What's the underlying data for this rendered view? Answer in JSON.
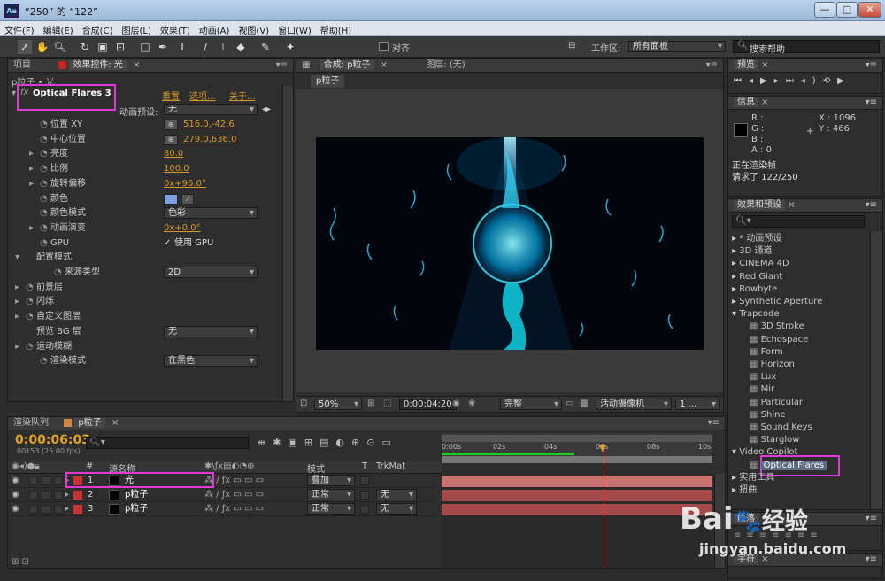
{
  "window": {
    "title": "“250” 的 “122”",
    "min": "—",
    "max": "□",
    "close": "✕"
  },
  "menu": [
    "文件(F)",
    "编辑(E)",
    "合成(C)",
    "图层(L)",
    "效果(T)",
    "动画(A)",
    "视图(V)",
    "窗口(W)",
    "帮助(H)"
  ],
  "toolbar": {
    "align_label": "对齐",
    "workspace_label": "工作区:",
    "workspace_value": "所有面板",
    "search_placeholder": "搜索帮助"
  },
  "left_panel": {
    "tab_project": "项目",
    "tab_effects": "效果控件: 光",
    "breadcrumb": "p粒子 • 光",
    "effect_name": "Optical Flares 3",
    "reset": "重置",
    "options": "选项...",
    "about": "关于...",
    "preset_label": "动画预设:",
    "preset_value": "无",
    "props": [
      {
        "label": "位置 XY",
        "value": "516.0,-42.6"
      },
      {
        "label": "中心位置",
        "value": "279.0,636.0"
      },
      {
        "label": "亮度",
        "value": "80.0"
      },
      {
        "label": "比例",
        "value": "100.0"
      },
      {
        "label": "旋转偏移",
        "value": "0x+96.0°"
      },
      {
        "label": "颜色",
        "value": ""
      },
      {
        "label": "颜色模式",
        "value": "色彩"
      },
      {
        "label": "动画演变",
        "value": "0x+0.0°"
      },
      {
        "label": "GPU",
        "value": "使用 GPU"
      },
      {
        "label": "配置模式",
        "value": ""
      },
      {
        "label": "来源类型",
        "value": "2D"
      },
      {
        "label": "前景层",
        "value": ""
      },
      {
        "label": "闪烁",
        "value": ""
      },
      {
        "label": "自定义图层",
        "value": ""
      },
      {
        "label": "预览 BG 层",
        "value": "无"
      },
      {
        "label": "运动模糊",
        "value": ""
      },
      {
        "label": "渲染模式",
        "value": "在黑色"
      }
    ]
  },
  "comp": {
    "tab": "合成: p粒子",
    "layer_tab": "图层: (无)",
    "sub_tab": "p粒子",
    "zoom": "50%",
    "timecode": "0:00:04:20",
    "resolution": "完整",
    "camera": "活动摄像机",
    "views": "1 ..."
  },
  "preview": {
    "title": "预览"
  },
  "info": {
    "title": "信息",
    "r": "R :",
    "g": "G :",
    "b": "B :",
    "a": "A : 0",
    "x": "X : 1096",
    "y": "Y : 466",
    "status1": "正在渲染帧",
    "status2": "请求了 122/250"
  },
  "effects_presets": {
    "title": "效果和预设",
    "search_placeholder": "",
    "items": [
      {
        "label": "* 动画预设",
        "type": "cat"
      },
      {
        "label": "3D 通道",
        "type": "cat"
      },
      {
        "label": "CINEMA 4D",
        "type": "cat"
      },
      {
        "label": "Red Giant",
        "type": "cat"
      },
      {
        "label": "Rowbyte",
        "type": "cat"
      },
      {
        "label": "Synthetic Aperture",
        "type": "cat"
      },
      {
        "label": "Trapcode",
        "type": "open"
      },
      {
        "label": "3D Stroke",
        "type": "fx"
      },
      {
        "label": "Echospace",
        "type": "fx"
      },
      {
        "label": "Form",
        "type": "fx"
      },
      {
        "label": "Horizon",
        "type": "fx"
      },
      {
        "label": "Lux",
        "type": "fx"
      },
      {
        "label": "Mir",
        "type": "fx"
      },
      {
        "label": "Particular",
        "type": "fx"
      },
      {
        "label": "Shine",
        "type": "fx"
      },
      {
        "label": "Sound Keys",
        "type": "fx"
      },
      {
        "label": "Starglow",
        "type": "fx"
      },
      {
        "label": "Video Copilot",
        "type": "open"
      },
      {
        "label": "Optical Flares",
        "type": "fx-sel"
      },
      {
        "label": "实用工具",
        "type": "cat"
      },
      {
        "label": "扭曲",
        "type": "cat"
      }
    ]
  },
  "bottom_right": {
    "tab1": "段落",
    "tab2": "字符"
  },
  "timeline": {
    "tab_render": "渲染队列",
    "tab_comp": "p粒子",
    "timecode": "0:00:06:03",
    "fps": "00153 (25.00 fps)",
    "col_num": "#",
    "col_name": "源名称",
    "col_mode": "模式",
    "col_t": "T",
    "col_trk": "TrkMat",
    "ruler": [
      "0:00s",
      "02s",
      "04s",
      "06s",
      "08s",
      "10s"
    ],
    "layers": [
      {
        "num": "1",
        "name": "光",
        "mode": "叠加",
        "trk": ""
      },
      {
        "num": "2",
        "name": "p粒子",
        "mode": "正常",
        "trk": "无"
      },
      {
        "num": "3",
        "name": "p粒子",
        "mode": "正常",
        "trk": "无"
      }
    ]
  },
  "watermark": {
    "brand": "Bai",
    "brand2": "经验",
    "url": "jingyan.baidu.com"
  }
}
